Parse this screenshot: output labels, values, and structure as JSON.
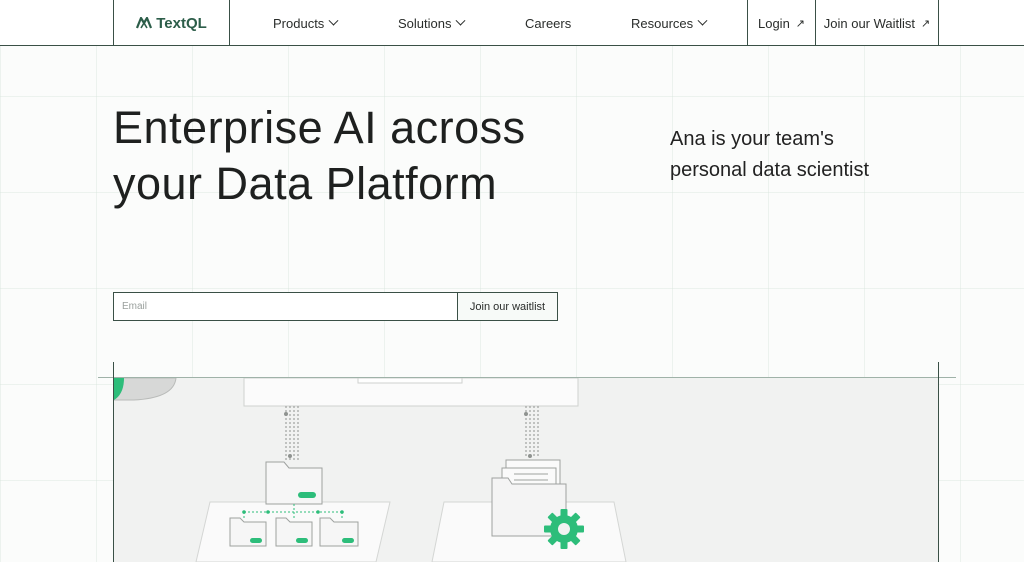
{
  "nav": {
    "logo_text": "TextQL",
    "menu": [
      {
        "label": "Products",
        "has_dropdown": true
      },
      {
        "label": "Solutions",
        "has_dropdown": true
      },
      {
        "label": "Careers",
        "has_dropdown": false
      },
      {
        "label": "Resources",
        "has_dropdown": true
      }
    ],
    "login_label": "Login",
    "waitlist_label": "Join our Waitlist"
  },
  "hero": {
    "headline_line1": "Enterprise AI across",
    "headline_line2": "your Data Platform",
    "subhead_line1": "Ana is your team's",
    "subhead_line2": "personal data scientist"
  },
  "form": {
    "email_placeholder": "Email",
    "email_value": "",
    "submit_label": "Join our waitlist"
  },
  "colors": {
    "brand": "#2c5d49",
    "accent_green": "#2dbd7a",
    "border": "#3a5046"
  },
  "icons": {
    "logo": "textql-logo-icon",
    "dropdown": "chevron-down-icon",
    "external": "arrow-up-right-icon",
    "folder": "folder-icon",
    "gear": "gear-icon"
  }
}
